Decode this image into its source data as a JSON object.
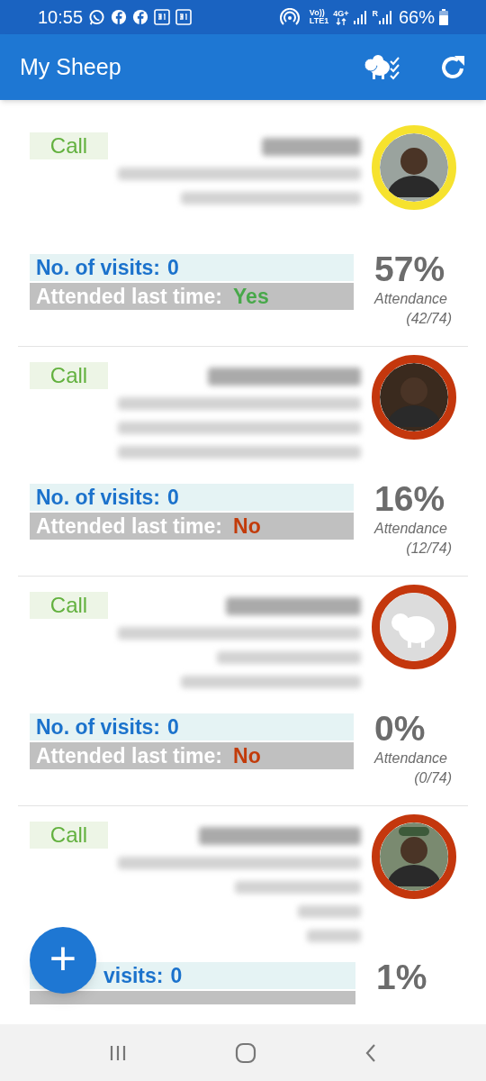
{
  "status_bar": {
    "time": "10:55",
    "volte": "Vo))",
    "lte": "LTE1",
    "network": "4G+",
    "roaming": "R",
    "battery": "66%"
  },
  "app_bar": {
    "title": "My Sheep"
  },
  "members": [
    {
      "call": "Call",
      "visits_label": "No. of visits:",
      "visits": "0",
      "attended_label": "Attended last time:",
      "attended": "Yes",
      "attended_yes": true,
      "percent": "57%",
      "attendance_label": "Attendance",
      "ratio": "(42/74)"
    },
    {
      "call": "Call",
      "visits_label": "No. of visits:",
      "visits": "0",
      "attended_label": "Attended last time:",
      "attended": "No",
      "attended_yes": false,
      "percent": "16%",
      "attendance_label": "Attendance",
      "ratio": "(12/74)"
    },
    {
      "call": "Call",
      "avatar": {
        "kind": "placeholder",
        "color": "#c4370d"
      },
      "visits_label": "No. of visits:",
      "visits": "0",
      "attended_label": "Attended last time:",
      "attended": "No",
      "attended_yes": false,
      "percent": "0%",
      "attendance_label": "Attendance",
      "ratio": "(0/74)"
    },
    {
      "call": "Call",
      "visits_label": "visits:",
      "visits_covered": true,
      "visits": "0",
      "percent": "1%"
    }
  ],
  "fab": {
    "label": "+"
  }
}
